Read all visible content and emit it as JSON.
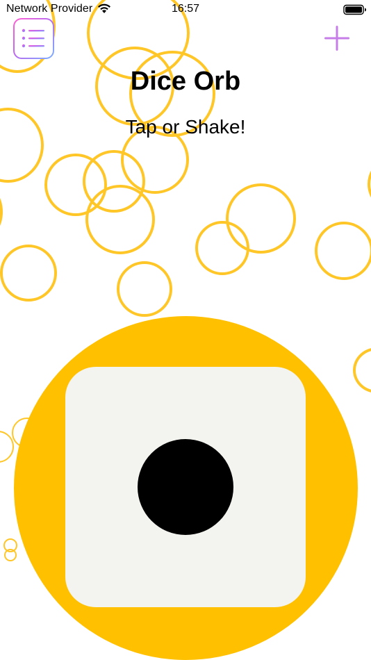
{
  "status_bar": {
    "carrier": "Network Provider",
    "time": "16:57",
    "wifi_icon": "wifi-icon",
    "battery_icon": "battery-icon"
  },
  "nav": {
    "menu_icon": "list-icon",
    "add_icon": "plus-icon"
  },
  "header": {
    "title": "Dice Orb",
    "subtitle": "Tap or Shake!"
  },
  "die": {
    "face_value": 1
  },
  "colors": {
    "orb": "#FFC000",
    "bubble_outline": "#FFC628",
    "die_face": "#F3F3EF",
    "pip": "#000000",
    "accent_purple": "#C77DE8",
    "menu_gradient_start": "#FF5FD2",
    "menu_gradient_end": "#7AB2FF"
  }
}
